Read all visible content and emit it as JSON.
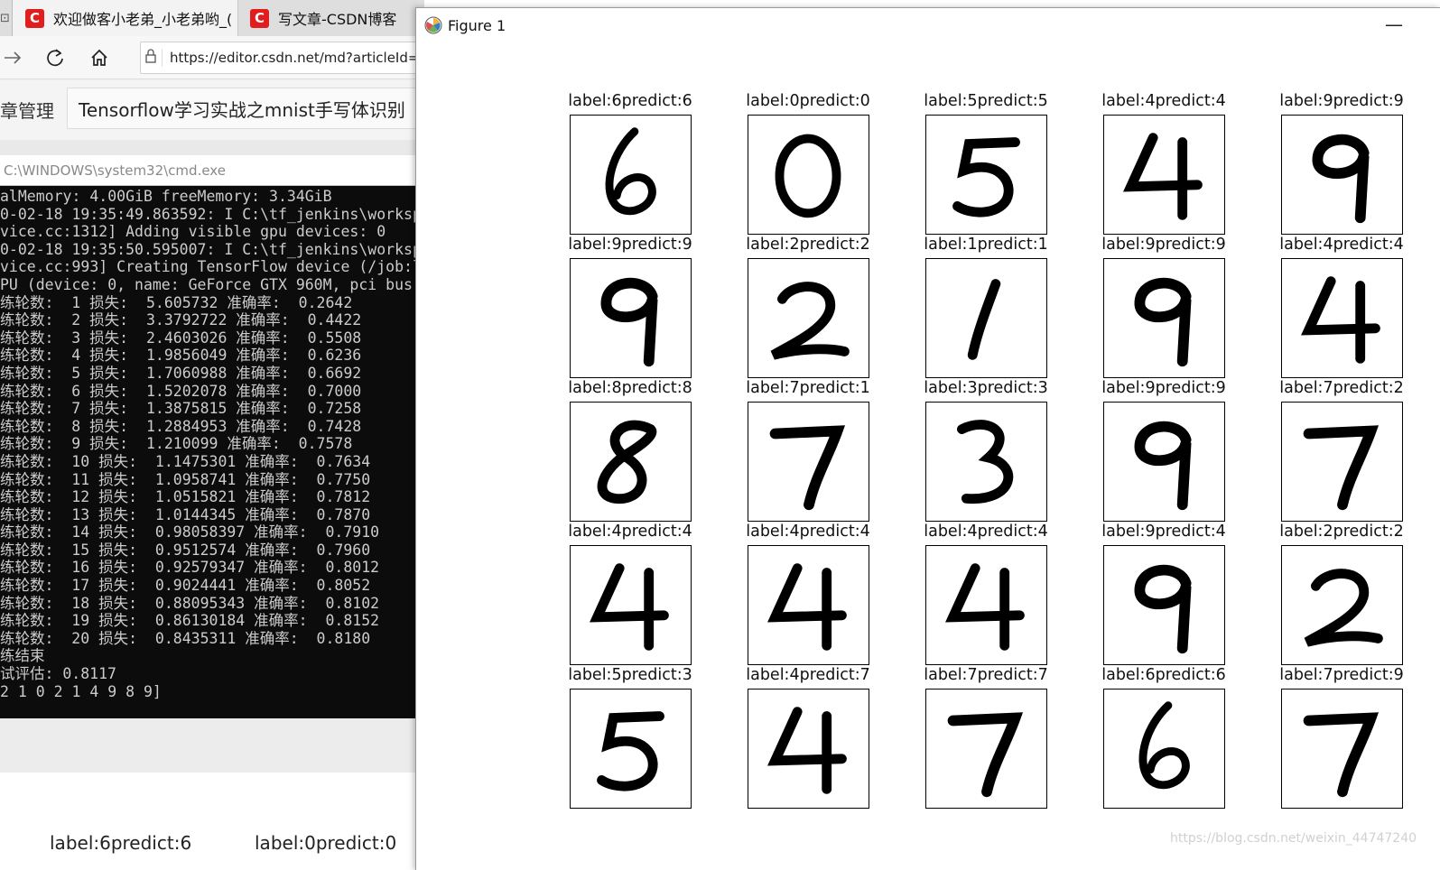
{
  "browser": {
    "tab_stub": "⊡",
    "tabs": [
      {
        "title": "欢迎做客小老弟_小老弟哟_(",
        "icon": "csdn-logo-icon"
      },
      {
        "title": "写文章-CSDN博客",
        "icon": "csdn-logo-icon"
      }
    ],
    "url": "https://editor.csdn.net/md?articleId=1",
    "manage_label": "文章管理",
    "article_title": "Tensorflow学习实战之mnist手写体识别",
    "bottom_labels": [
      "label:6predict:6",
      "label:0predict:0"
    ]
  },
  "cmd": {
    "title": "C:\\WINDOWS\\system32\\cmd.exe",
    "lines": [
      "alMemory: 4.00GiB freeMemory: 3.34GiB",
      "0-02-18 19:35:49.863592: I C:\\tf_jenkins\\worksp",
      "vice.cc:1312] Adding visible gpu devices: 0",
      "0-02-18 19:35:50.595007: I C:\\tf_jenkins\\worksp",
      "vice.cc:993] Creating TensorFlow device (/job:l",
      "PU (device: 0, name: GeForce GTX 960M, pci bus",
      "练轮数:  1 损失:  5.605732 准确率:  0.2642",
      "练轮数:  2 损失:  3.3792722 准确率:  0.4422",
      "练轮数:  3 损失:  2.4603026 准确率:  0.5508",
      "练轮数:  4 损失:  1.9856049 准确率:  0.6236",
      "练轮数:  5 损失:  1.7060988 准确率:  0.6692",
      "练轮数:  6 损失:  1.5202078 准确率:  0.7000",
      "练轮数:  7 损失:  1.3875815 准确率:  0.7258",
      "练轮数:  8 损失:  1.2884953 准确率:  0.7428",
      "练轮数:  9 损失:  1.210099 准确率:  0.7578",
      "练轮数:  10 损失:  1.1475301 准确率:  0.7634",
      "练轮数:  11 损失:  1.0958741 准确率:  0.7750",
      "练轮数:  12 损失:  1.0515821 准确率:  0.7812",
      "练轮数:  13 损失:  1.0144345 准确率:  0.7870",
      "练轮数:  14 损失:  0.98058397 准确率:  0.7910",
      "练轮数:  15 损失:  0.9512574 准确率:  0.7960",
      "练轮数:  16 损失:  0.92579347 准确率:  0.8012",
      "练轮数:  17 损失:  0.9024441 准确率:  0.8052",
      "练轮数:  18 损失:  0.88095343 准确率:  0.8102",
      "练轮数:  19 损失:  0.86130184 准确率:  0.8152",
      "练轮数:  20 损失:  0.8435311 准确率:  0.8180",
      "练结束",
      "试评估: 0.8117",
      "2 1 0 2 1 4 9 8 9]"
    ]
  },
  "figure": {
    "title": "Figure 1",
    "minimize_glyph": "—",
    "panels": [
      {
        "label": "label:6predict:6",
        "digit": "6"
      },
      {
        "label": "label:0predict:0",
        "digit": "0"
      },
      {
        "label": "label:5predict:5",
        "digit": "5"
      },
      {
        "label": "label:4predict:4",
        "digit": "4"
      },
      {
        "label": "label:9predict:9",
        "digit": "9"
      },
      {
        "label": "label:9predict:9",
        "digit": "9"
      },
      {
        "label": "label:2predict:2",
        "digit": "2"
      },
      {
        "label": "label:1predict:1",
        "digit": "1"
      },
      {
        "label": "label:9predict:9",
        "digit": "9"
      },
      {
        "label": "label:4predict:4",
        "digit": "4"
      },
      {
        "label": "label:8predict:8",
        "digit": "8"
      },
      {
        "label": "label:7predict:1",
        "digit": "7"
      },
      {
        "label": "label:3predict:3",
        "digit": "3"
      },
      {
        "label": "label:9predict:9",
        "digit": "9"
      },
      {
        "label": "label:7predict:2",
        "digit": "7"
      },
      {
        "label": "label:4predict:4",
        "digit": "4"
      },
      {
        "label": "label:4predict:4",
        "digit": "4"
      },
      {
        "label": "label:4predict:4",
        "digit": "4"
      },
      {
        "label": "label:9predict:4",
        "digit": "9"
      },
      {
        "label": "label:2predict:2",
        "digit": "2"
      },
      {
        "label": "label:5predict:3",
        "digit": "5"
      },
      {
        "label": "label:4predict:7",
        "digit": "4"
      },
      {
        "label": "label:7predict:7",
        "digit": "7"
      },
      {
        "label": "label:6predict:6",
        "digit": "6"
      },
      {
        "label": "label:7predict:9",
        "digit": "7"
      }
    ],
    "watermark": "https://blog.csdn.net/weixin_44747240"
  }
}
